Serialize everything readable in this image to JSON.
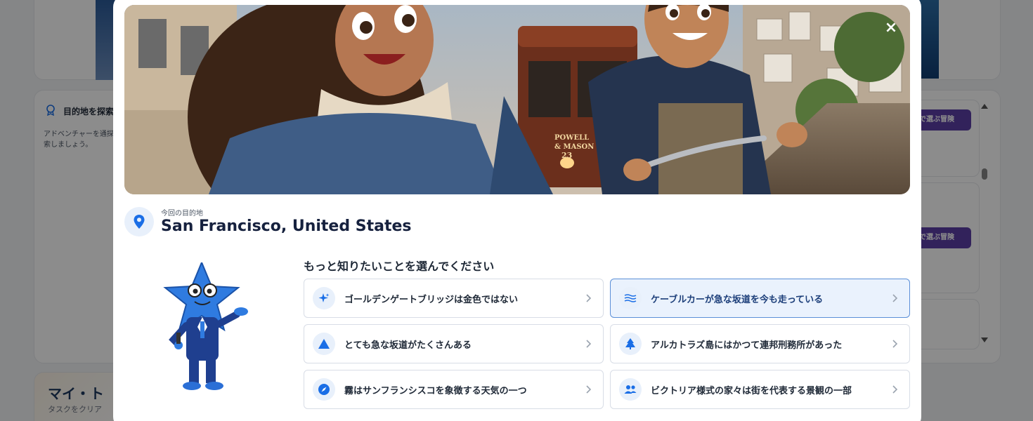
{
  "modal": {
    "close_symbol": "×",
    "hero_image": "kids-biking-cable-car",
    "hero_sign": "POWELL & MASON 23",
    "destination": {
      "label": "今回の目的地",
      "name": "San Francisco, United States",
      "icon": "location-pin-icon"
    },
    "prompt": "もっと知りたいことを選んでください",
    "options": [
      {
        "label": "ゴールデンゲートブリッジは金色ではない",
        "icon": "sparkle-icon",
        "selected": false
      },
      {
        "label": "ケーブルカーが急な坂道を今も走っている",
        "icon": "waves-icon",
        "selected": true
      },
      {
        "label": "とても急な坂道がたくさんある",
        "icon": "triangle-icon",
        "selected": false
      },
      {
        "label": "アルカトラズ島にはかつて連邦刑務所があった",
        "icon": "tree-icon",
        "selected": false
      },
      {
        "label": "霧はサンフランシスコを象徴する天気の一つ",
        "icon": "compass-icon",
        "selected": false
      },
      {
        "label": "ビクトリア様式の家々は街を代表する景観の一部",
        "icon": "people-icon",
        "selected": false
      }
    ]
  },
  "background": {
    "side_title": "目的地を探索",
    "side_text": "アドベンチャーを通探索しましょう。",
    "button_label": "で選ぶ冒険",
    "bottom_title": "マイ・ト",
    "bottom_sub": "タスクをクリア"
  },
  "colors": {
    "accent": "#1a6ee6",
    "selected_bg": "#eaf2fd",
    "button_purple": "#5b3fa6"
  }
}
